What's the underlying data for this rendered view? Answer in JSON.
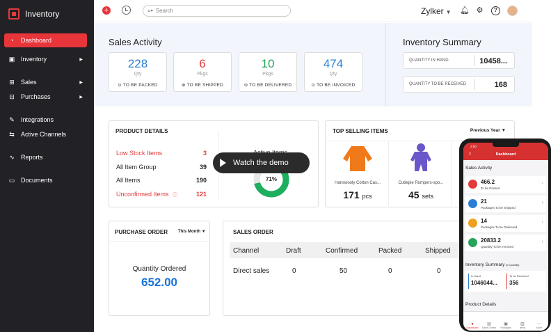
{
  "app": {
    "title": "Inventory"
  },
  "sidebar": {
    "items": [
      {
        "label": "Dashboard",
        "icon": "dashboard-icon"
      },
      {
        "label": "Inventory",
        "icon": "inventory-icon"
      },
      {
        "label": "Sales",
        "icon": "cart-icon"
      },
      {
        "label": "Purchases",
        "icon": "bag-icon"
      },
      {
        "label": "Integrations",
        "icon": "integrations-icon"
      },
      {
        "label": "Active Channels",
        "icon": "channels-icon"
      },
      {
        "label": "Reports",
        "icon": "chart-icon"
      },
      {
        "label": "Documents",
        "icon": "folder-icon"
      }
    ]
  },
  "topbar": {
    "search_placeholder": "Search",
    "org_name": "Zylker"
  },
  "sales_activity": {
    "title": "Sales Activity",
    "cards": [
      {
        "value": "228",
        "unit": "Qty",
        "label": "TO BE PACKED",
        "color": "#2a7fd4"
      },
      {
        "value": "6",
        "unit": "Pkgs",
        "label": "TO BE SHIPPED",
        "color": "#e23b3b"
      },
      {
        "value": "10",
        "unit": "Pkgs",
        "label": "TO BE DELIVERED",
        "color": "#27a35a"
      },
      {
        "value": "474",
        "unit": "Qty",
        "label": "TO BE INVOICED",
        "color": "#2a7fd4"
      }
    ]
  },
  "inventory_summary": {
    "title": "Inventory Summary",
    "rows": [
      {
        "label": "QUANTITY IN HAND",
        "value": "10458..."
      },
      {
        "label": "QUANTITY TO BE RECEIVED",
        "value": "168"
      }
    ]
  },
  "product_details": {
    "title": "PRODUCT DETAILS",
    "rows": [
      {
        "label": "Low Stock Items",
        "value": "3"
      },
      {
        "label": "All Item Group",
        "value": "39"
      },
      {
        "label": "All Items",
        "value": "190"
      },
      {
        "label": "Unconfirmed Items",
        "value": "121"
      }
    ],
    "donut_title": "Active Items",
    "donut_percent": "71%",
    "donut_fraction": 0.71
  },
  "demo_button": {
    "label": "Watch the demo"
  },
  "top_selling": {
    "title": "TOP SELLING ITEMS",
    "period": "Previous Year",
    "items": [
      {
        "name": "Hanswooly Cotton Cas...",
        "count": "171",
        "unit": "pcs"
      },
      {
        "name": "Cutiepie Rompers-spo...",
        "count": "45",
        "unit": "sets"
      }
    ]
  },
  "purchase_order": {
    "title": "PURCHASE ORDER",
    "period": "This Month",
    "label": "Quantity Ordered",
    "value": "652.00"
  },
  "sales_order": {
    "title": "SALES ORDER",
    "columns": [
      "Channel",
      "Draft",
      "Confirmed",
      "Packed",
      "Shipped"
    ],
    "rows": [
      [
        "Direct sales",
        "0",
        "50",
        "0",
        "0"
      ]
    ]
  },
  "phone": {
    "time": "2:50",
    "header": "Dashboard",
    "section": "Sales Activity",
    "rows": [
      {
        "value": "466.2",
        "label": "To be Packed",
        "color": "#e23b3b"
      },
      {
        "value": "21",
        "label": "Packages To be Shipped",
        "color": "#2a7fd4"
      },
      {
        "value": "14",
        "label": "Packages To be Delivered",
        "color": "#f0a020"
      },
      {
        "value": "20833.2",
        "label": "Quantity To be Invoiced",
        "color": "#27a35a"
      }
    ],
    "inv_title": "Inventory Summary",
    "inv_sub": "(In Quantity)",
    "in_hand_label": "In Hand",
    "in_hand_value": "1046044...",
    "receive_label": "To be Received",
    "receive_value": "356",
    "product_details": "Product Details",
    "tabs": [
      "Dashboard",
      "Sales Orders",
      "Packages",
      "Items",
      "More"
    ]
  }
}
